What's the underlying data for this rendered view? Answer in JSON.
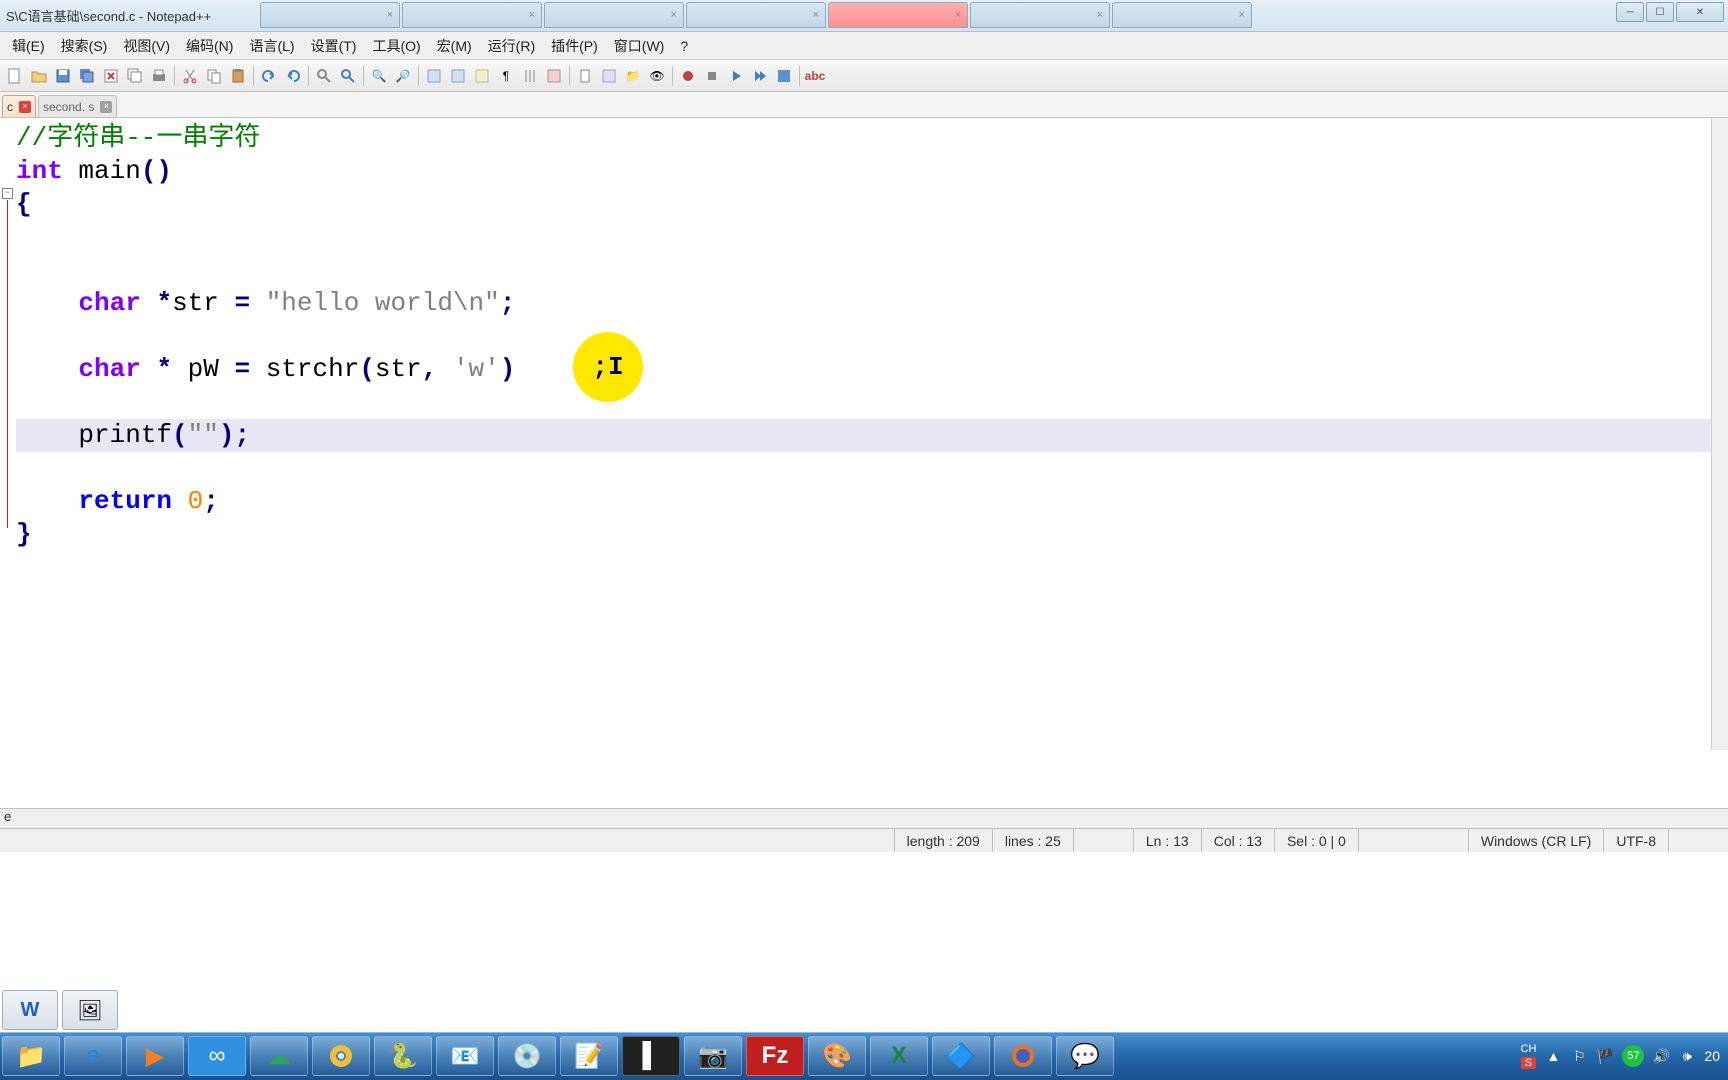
{
  "titlebar": {
    "text": "S\\C语言基础\\second.c - Notepad++"
  },
  "browser_tabs": [
    {
      "label": ""
    },
    {
      "label": ""
    },
    {
      "label": ""
    },
    {
      "label": ""
    },
    {
      "label": "",
      "active": true
    },
    {
      "label": ""
    },
    {
      "label": ""
    }
  ],
  "menu": {
    "items": [
      "辑(E)",
      "搜索(S)",
      "视图(V)",
      "编码(N)",
      "语言(L)",
      "设置(T)",
      "工具(O)",
      "宏(M)",
      "运行(R)",
      "插件(P)",
      "窗口(W)",
      "?"
    ]
  },
  "file_tabs": [
    {
      "name": "c",
      "active": true
    },
    {
      "name": "second. s",
      "active": false
    }
  ],
  "code": {
    "line1_comment": "//字符串--一串字符",
    "line2_int": "int",
    "line2_main": " main",
    "line2_paren": "()",
    "line3_brace": "{",
    "line5_indent": "    ",
    "line5_char": "char",
    "line5_star": " *",
    "line5_str": "str ",
    "line5_eq": "= ",
    "line5_val": "\"hello world\\n\"",
    "line5_semi": ";",
    "line7_char": "char",
    "line7_star2": " * ",
    "line7_pw": "pW ",
    "line7_eq": "= ",
    "line7_func": "strchr",
    "line7_open": "(",
    "line7_arg1": "str",
    "line7_comma": ", ",
    "line7_ch": "'w'",
    "line7_close": ")",
    "line7_semi": ";",
    "line9_printf": "printf",
    "line9_open": "(",
    "line9_str": "\"\"",
    "line9_close": ")",
    "line9_semi": ";",
    "line11_return": "return",
    "line11_sp": " ",
    "line11_zero": "0",
    "line11_semi": ";",
    "line12_brace": "}"
  },
  "highlight_inner": ";I",
  "breadcrumb": "e",
  "status": {
    "length": "length : 209",
    "lines": "lines : 25",
    "ln": "Ln : 13",
    "col": "Col : 13",
    "sel": "Sel : 0 | 0",
    "eol": "Windows (CR LF)",
    "enc": "UTF-8"
  },
  "tray": {
    "ime1": "CH",
    "ime2": "S",
    "badge": "57",
    "time": "20"
  }
}
